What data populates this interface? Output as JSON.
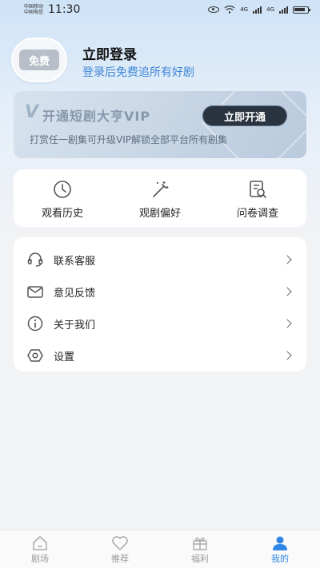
{
  "status_bar": {
    "carrier_1": "中国移动",
    "carrier_2": "中国电信",
    "time": "11:30",
    "network_1": "4G",
    "network_2": "4G",
    "battery": "battery-icon"
  },
  "profile": {
    "avatar_label": "免费",
    "title": "立即登录",
    "subtitle": "登录后免费追所有好剧"
  },
  "vip": {
    "logo": "V",
    "title": "开通短剧大亨VIP",
    "description": "打赏任一剧集可升级VIP解锁全部平台所有剧集",
    "button": "立即开通"
  },
  "shortcuts": [
    {
      "label": "观看历史",
      "icon": "clock-icon"
    },
    {
      "label": "观剧偏好",
      "icon": "magic-wand-icon"
    },
    {
      "label": "问卷调查",
      "icon": "survey-icon"
    }
  ],
  "menu": [
    {
      "label": "联系客服",
      "icon": "headset-icon"
    },
    {
      "label": "意见反馈",
      "icon": "mail-icon"
    },
    {
      "label": "关于我们",
      "icon": "info-icon"
    },
    {
      "label": "设置",
      "icon": "settings-icon"
    }
  ],
  "bottom_nav": [
    {
      "label": "剧场",
      "icon": "home-icon"
    },
    {
      "label": "推荐",
      "icon": "heart-icon"
    },
    {
      "label": "福利",
      "icon": "gift-icon"
    },
    {
      "label": "我的",
      "icon": "user-icon",
      "active": true
    }
  ],
  "colors": {
    "accent": "#2f86e6",
    "link": "#3f86d6",
    "vip_button": "#2a3340"
  }
}
